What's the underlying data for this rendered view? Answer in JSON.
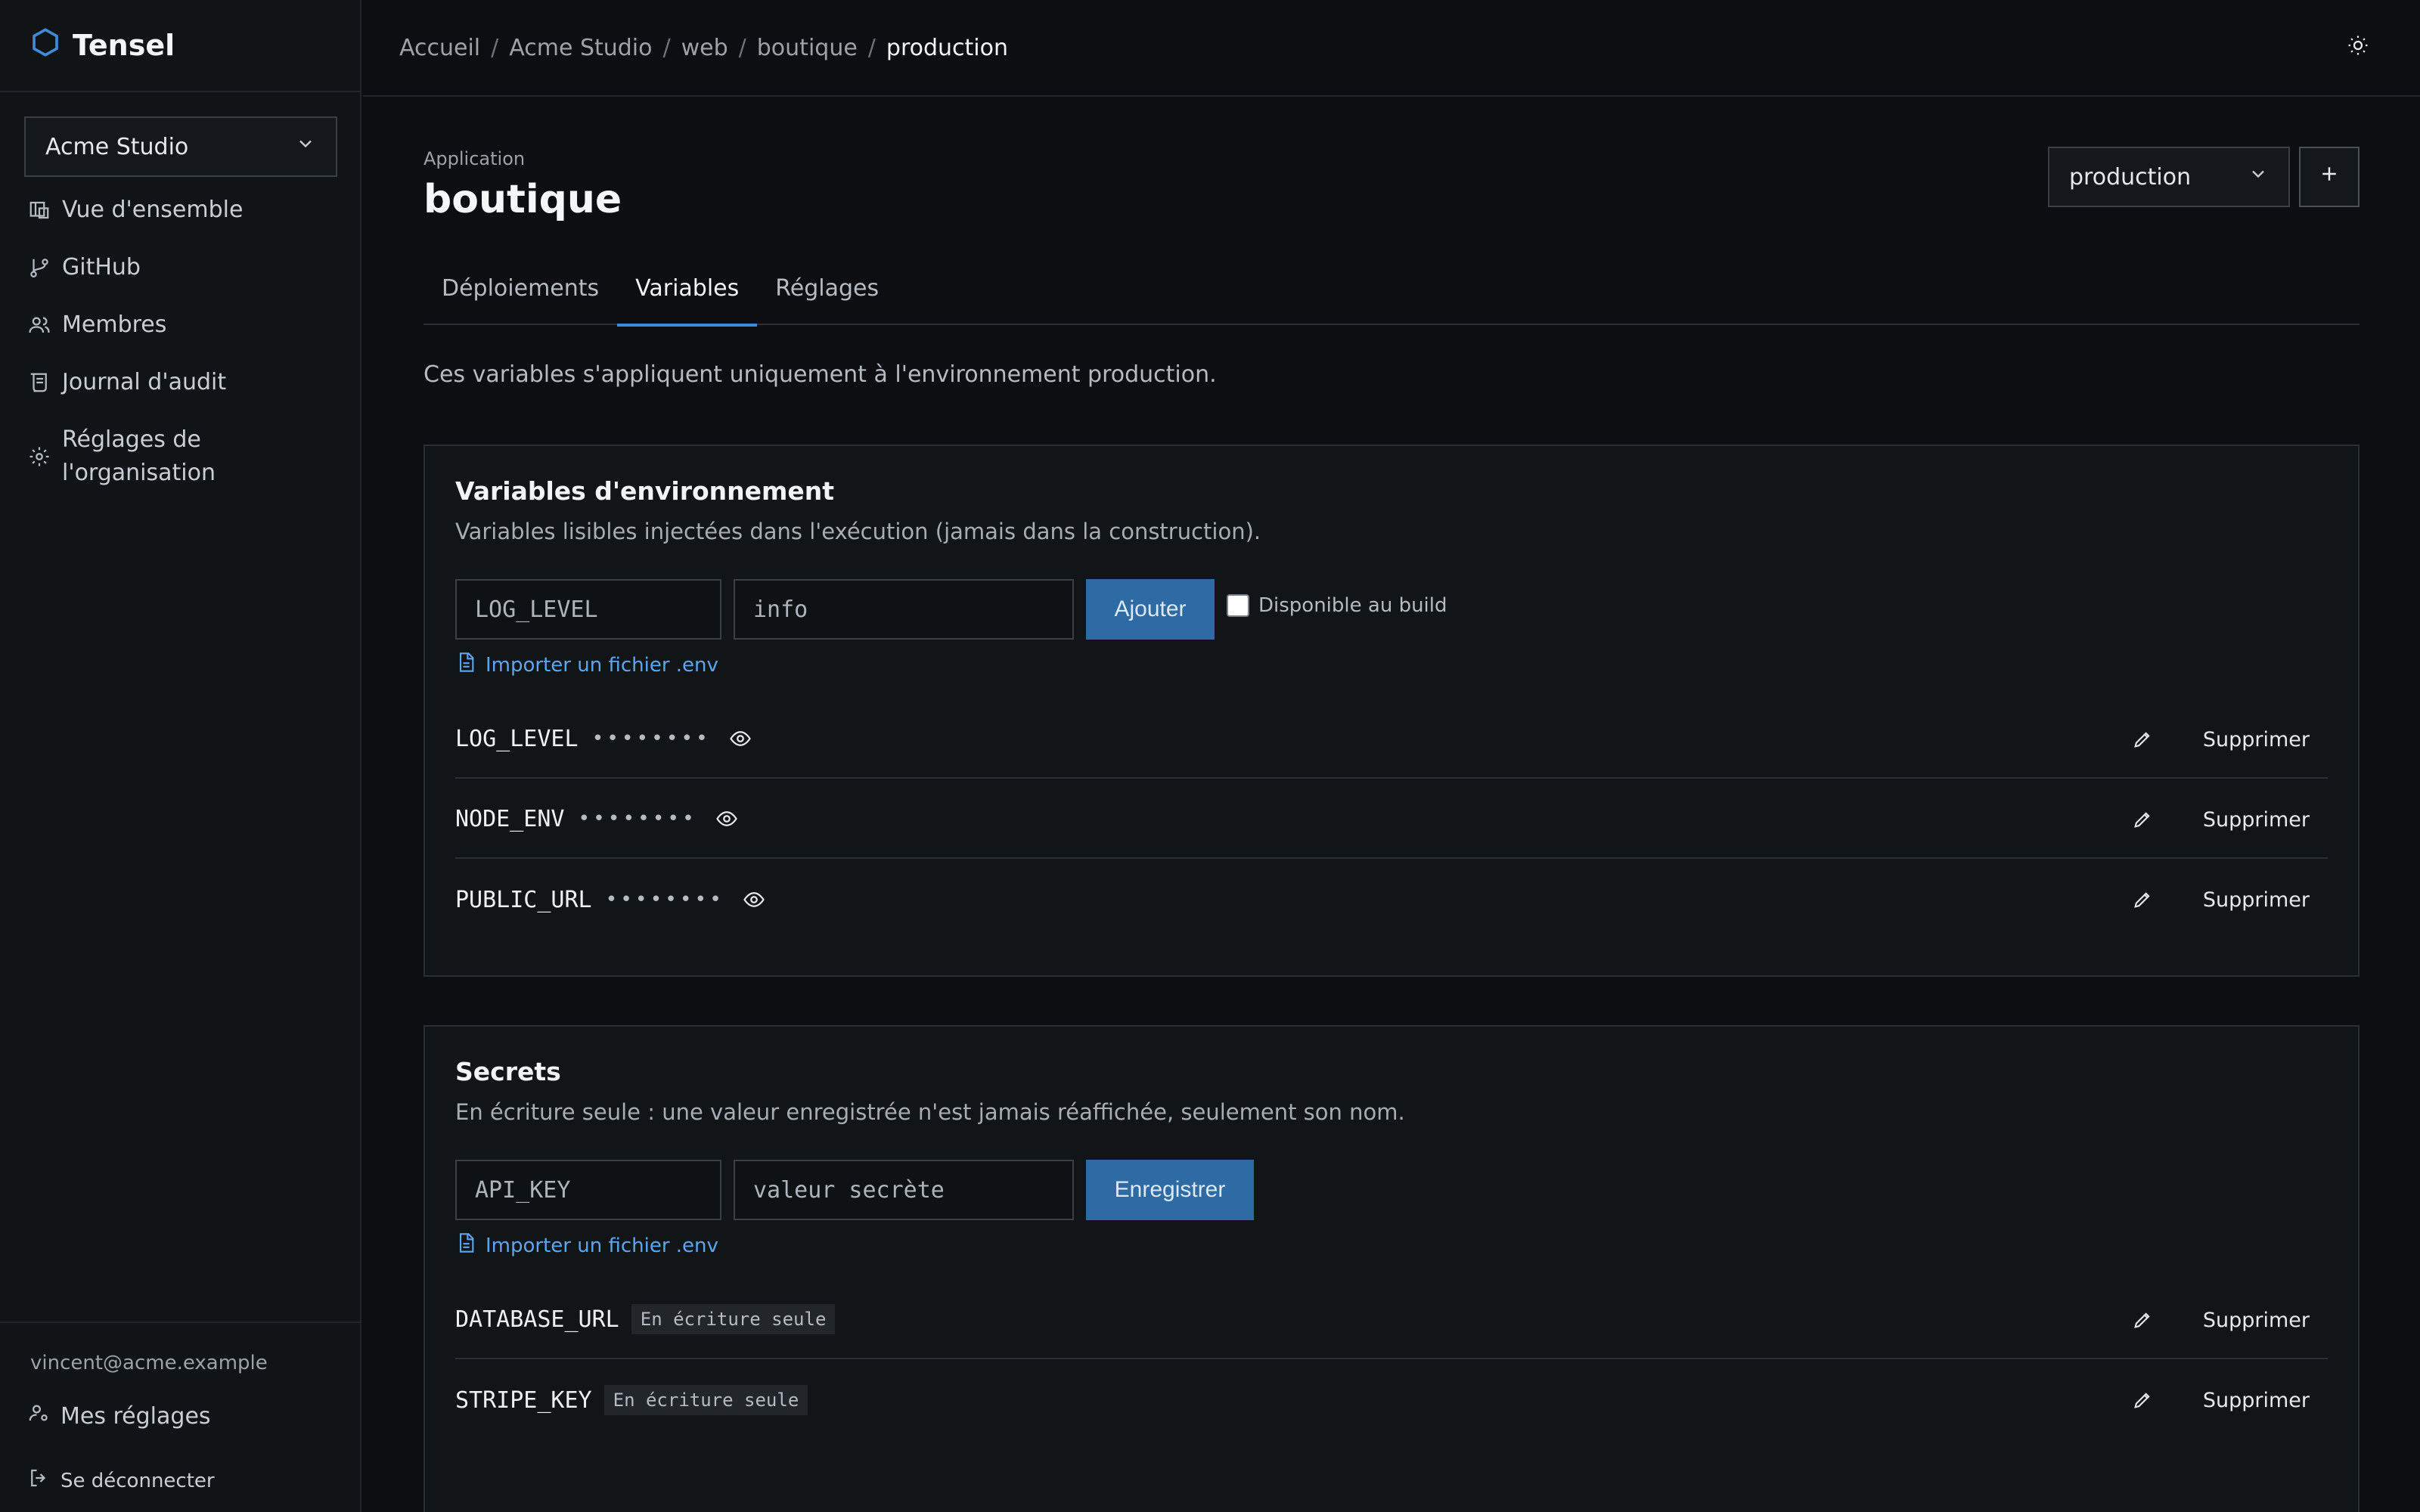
{
  "app": {
    "brand": "Tensel"
  },
  "sidebar": {
    "org_select": "Acme Studio",
    "items": [
      {
        "label": "Vue d'ensemble"
      },
      {
        "label": "GitHub"
      },
      {
        "label": "Membres"
      },
      {
        "label": "Journal d'audit"
      },
      {
        "label_line1": "Réglages de",
        "label_line2": "l'organisation"
      }
    ],
    "user_email": "vincent@acme.example",
    "my_settings": "Mes réglages",
    "logout": "Se déconnecter"
  },
  "breadcrumb": [
    "Accueil",
    "Acme Studio",
    "web",
    "boutique",
    "production"
  ],
  "main": {
    "app_label": "Application",
    "app_name": "boutique",
    "env_select": "production",
    "tabs": [
      {
        "label": "Déploiements",
        "active": false
      },
      {
        "label": "Variables",
        "active": true
      },
      {
        "label": "Réglages",
        "active": false
      }
    ],
    "intro": "Ces variables s'appliquent uniquement à l'environnement production."
  },
  "env_vars": {
    "title": "Variables d'environnement",
    "description": "Variables lisibles injectées dans l'exécution (jamais dans la construction).",
    "name_placeholder": "LOG_LEVEL",
    "value_placeholder": "info",
    "add_label": "Ajouter",
    "build_checkbox_label": "Disponible au build",
    "import_label": "Importer un fichier .env",
    "masked": "••••••••",
    "delete_label": "Supprimer",
    "rows": [
      {
        "name": "LOG_LEVEL"
      },
      {
        "name": "NODE_ENV"
      },
      {
        "name": "PUBLIC_URL"
      }
    ]
  },
  "secrets": {
    "title": "Secrets",
    "description": "En écriture seule : une valeur enregistrée n'est jamais réaffichée, seulement son nom.",
    "name_placeholder": "API_KEY",
    "value_placeholder": "valeur secrète",
    "save_label": "Enregistrer",
    "import_label": "Importer un fichier .env",
    "badge": "En écriture seule",
    "delete_label": "Supprimer",
    "rows": [
      {
        "name": "DATABASE_URL"
      },
      {
        "name": "STRIPE_KEY"
      }
    ]
  },
  "colors": {
    "accent": "#3d8bd9",
    "primary_button": "#2e6aa3",
    "link": "#5aa7f0"
  }
}
